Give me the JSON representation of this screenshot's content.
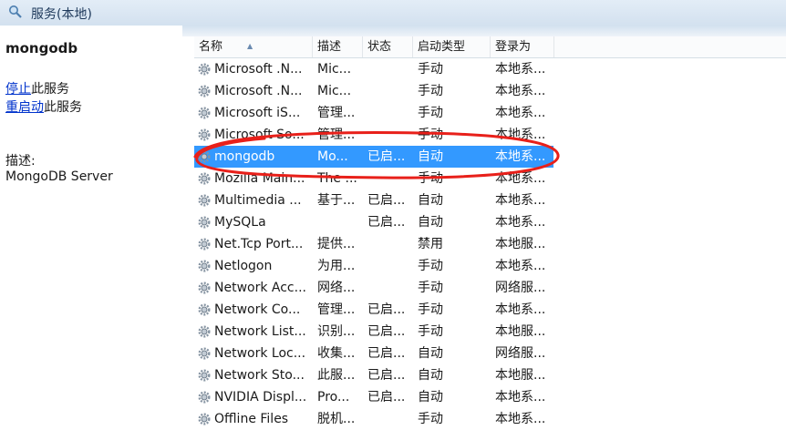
{
  "window": {
    "title": "服务(本地)"
  },
  "left_pane": {
    "service_name": "mongodb",
    "stop_link": "停止",
    "stop_suffix": "此服务",
    "restart_link": "重启动",
    "restart_suffix": "此服务",
    "description_label": "描述:",
    "description": "MongoDB Server"
  },
  "table": {
    "columns": [
      "名称",
      "描述",
      "状态",
      "启动类型",
      "登录为"
    ],
    "sorted_column": "名称",
    "selected_row": 4,
    "rows": [
      {
        "name": "Microsoft .N...",
        "desc": "Mic...",
        "status": "",
        "startup": "手动",
        "logon": "本地系..."
      },
      {
        "name": "Microsoft .N...",
        "desc": "Mic...",
        "status": "",
        "startup": "手动",
        "logon": "本地系..."
      },
      {
        "name": "Microsoft iS...",
        "desc": "管理...",
        "status": "",
        "startup": "手动",
        "logon": "本地系..."
      },
      {
        "name": "Microsoft So...",
        "desc": "管理...",
        "status": "",
        "startup": "手动",
        "logon": "本地系..."
      },
      {
        "name": "mongodb",
        "desc": "Mo...",
        "status": "已启...",
        "startup": "自动",
        "logon": "本地系..."
      },
      {
        "name": "Mozilla Main...",
        "desc": "The ...",
        "status": "",
        "startup": "手动",
        "logon": "本地系..."
      },
      {
        "name": "Multimedia ...",
        "desc": "基于...",
        "status": "已启...",
        "startup": "自动",
        "logon": "本地系..."
      },
      {
        "name": "MySQLa",
        "desc": "",
        "status": "已启...",
        "startup": "自动",
        "logon": "本地系..."
      },
      {
        "name": "Net.Tcp Port...",
        "desc": "提供...",
        "status": "",
        "startup": "禁用",
        "logon": "本地服..."
      },
      {
        "name": "Netlogon",
        "desc": "为用...",
        "status": "",
        "startup": "手动",
        "logon": "本地系..."
      },
      {
        "name": "Network Acc...",
        "desc": "网络...",
        "status": "",
        "startup": "手动",
        "logon": "网络服..."
      },
      {
        "name": "Network Co...",
        "desc": "管理...",
        "status": "已启...",
        "startup": "手动",
        "logon": "本地系..."
      },
      {
        "name": "Network List...",
        "desc": "识别...",
        "status": "已启...",
        "startup": "手动",
        "logon": "本地服..."
      },
      {
        "name": "Network Loc...",
        "desc": "收集...",
        "status": "已启...",
        "startup": "自动",
        "logon": "网络服..."
      },
      {
        "name": "Network Sto...",
        "desc": "此服...",
        "status": "已启...",
        "startup": "自动",
        "logon": "本地服..."
      },
      {
        "name": "NVIDIA Displ...",
        "desc": "Pro...",
        "status": "已启...",
        "startup": "自动",
        "logon": "本地系..."
      },
      {
        "name": "Offline Files",
        "desc": "脱机...",
        "status": "",
        "startup": "手动",
        "logon": "本地系..."
      }
    ]
  },
  "annotation": {
    "color": "#e8201a"
  },
  "colors": {
    "selection": "#3399ff",
    "link": "#0033cc"
  },
  "icons": {
    "title": "services-magnifier-icon",
    "row": "gear-icon"
  }
}
